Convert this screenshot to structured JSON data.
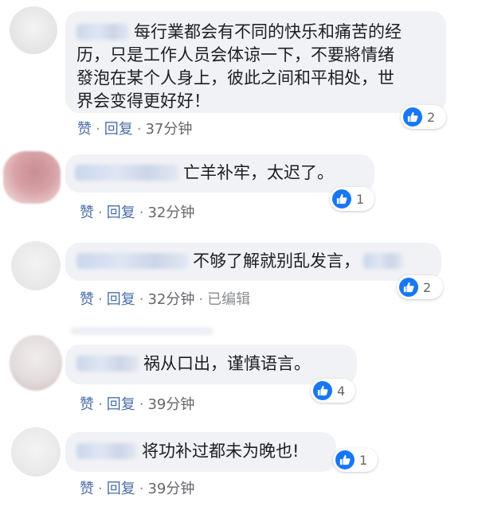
{
  "comments": [
    {
      "text": "每行業都会有不同的快乐和痛苦的经历，只是工作人员会体谅一下，不要將情绪發泡在某个人身上，彼此之间和平相处，世界会变得更好好！",
      "text_lines": [
        "每行業都会有不同的快乐和痛苦的经",
        "历，只是工作人员会体谅一下，不要將情绪",
        "發泡在某个人身上，彼此之间和平相处，世",
        "界会变得更好好！"
      ],
      "reaction_count": "2",
      "like_label": "赞",
      "reply_label": "回复",
      "time": "37分钟",
      "edited": ""
    },
    {
      "text": "亡羊补牢，太迟了。",
      "reaction_count": "1",
      "like_label": "赞",
      "reply_label": "回复",
      "time": "32分钟",
      "edited": ""
    },
    {
      "text": "不够了解就别乱发言，",
      "reaction_count": "2",
      "like_label": "赞",
      "reply_label": "回复",
      "time": "32分钟",
      "edited": "已编辑"
    },
    {
      "text": "祸从口出，谨慎语言。",
      "reaction_count": "4",
      "like_label": "赞",
      "reply_label": "回复",
      "time": "39分钟",
      "edited": ""
    },
    {
      "text": "将功补过都未为晚也!",
      "reaction_count": "1",
      "like_label": "赞",
      "reply_label": "回复",
      "time": "39分钟",
      "edited": ""
    }
  ],
  "separator": "·",
  "colors": {
    "bubble": "#f0f2f5",
    "link": "#4b6ea8",
    "like_blue": "#1877f2"
  }
}
